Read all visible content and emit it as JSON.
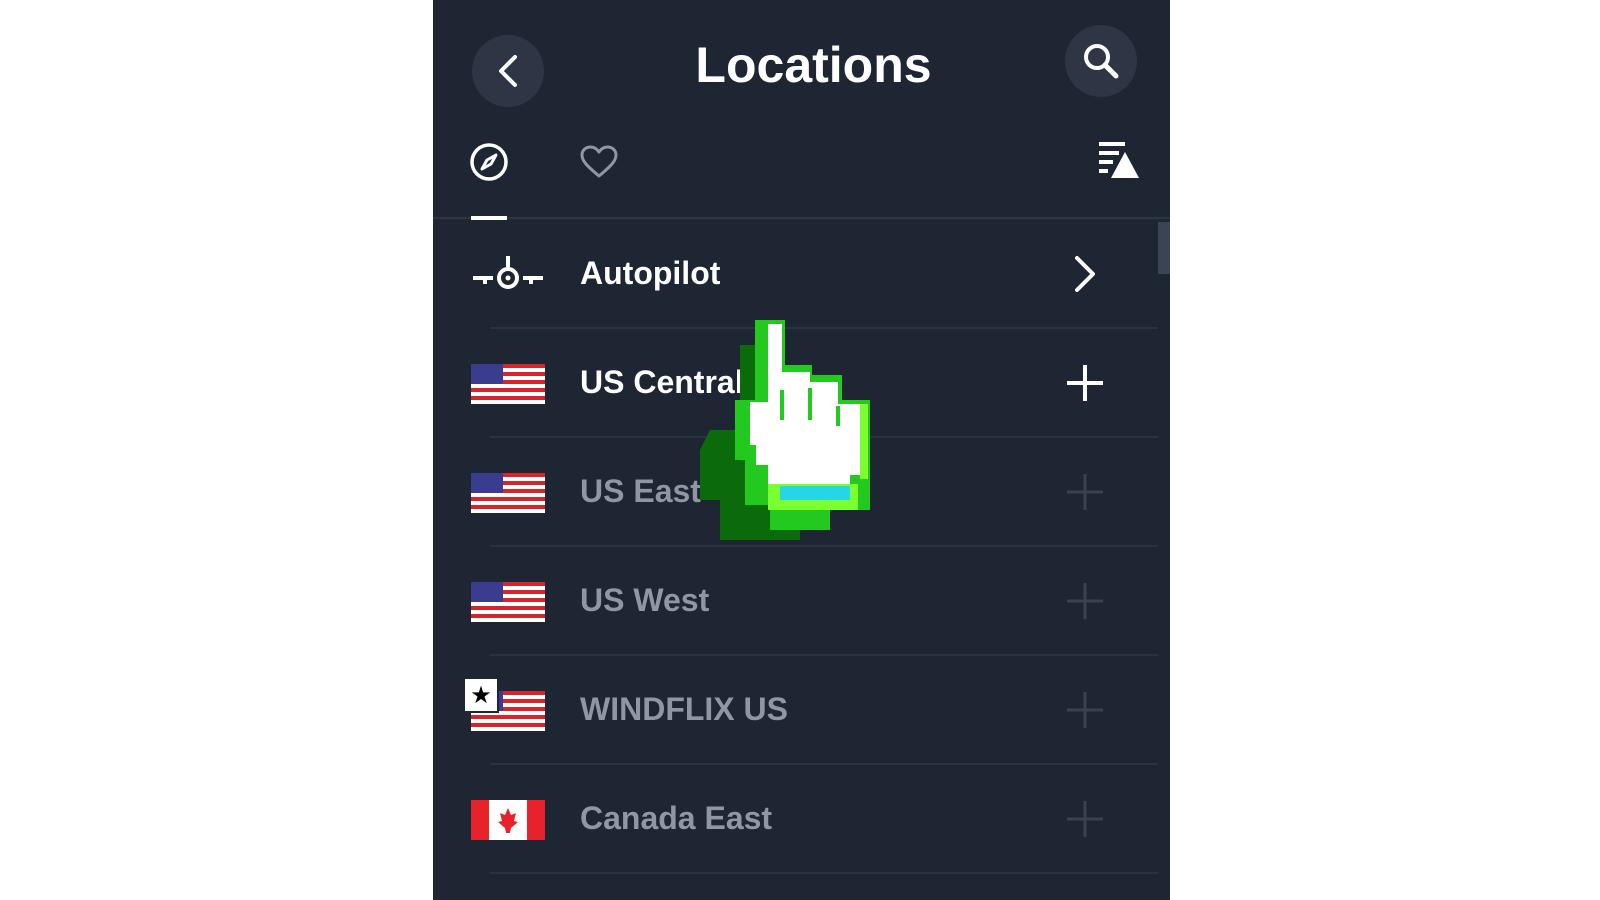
{
  "header": {
    "title": "Locations",
    "back_icon": "chevron-left-icon",
    "search_icon": "search-icon"
  },
  "tabs": [
    {
      "name": "explore",
      "icon": "compass-icon",
      "active": true
    },
    {
      "name": "favorites",
      "icon": "heart-icon",
      "active": false
    }
  ],
  "sort_icon": "sort-icon",
  "locations": [
    {
      "label": "Autopilot",
      "icon": "autopilot-icon",
      "action_icon": "chevron-right-icon",
      "dim": false
    },
    {
      "label": "US Central",
      "icon": "us-flag-icon",
      "action_icon": "plus-icon",
      "dim": false
    },
    {
      "label": "US East",
      "icon": "us-flag-icon",
      "action_icon": "plus-icon",
      "dim": true
    },
    {
      "label": "US West",
      "icon": "us-flag-icon",
      "action_icon": "plus-icon",
      "dim": true
    },
    {
      "label": "WINDFLIX US",
      "icon": "us-flag-icon",
      "badge_icon": "star-icon",
      "badge": "★",
      "action_icon": "plus-icon",
      "dim": true
    },
    {
      "label": "Canada East",
      "icon": "canada-flag-icon",
      "action_icon": "plus-icon",
      "dim": true
    }
  ],
  "cursor_icon": "hand-pointer-icon",
  "colors": {
    "panel_bg": "#1e2533",
    "button_bg": "#2e3646",
    "text_primary": "#ffffff",
    "text_dim": "#9097a2",
    "divider": "#2b3342"
  }
}
